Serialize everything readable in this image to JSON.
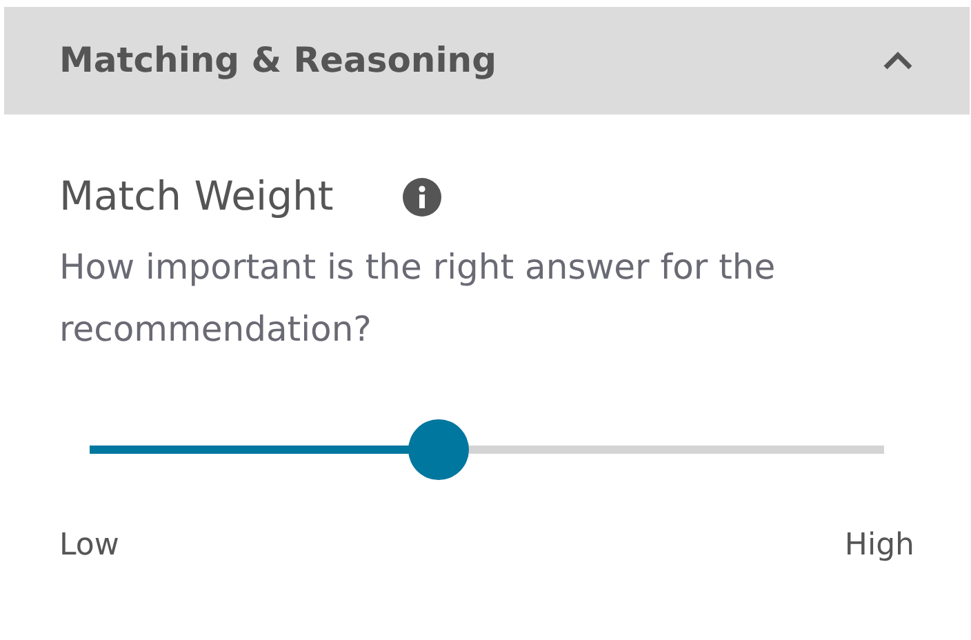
{
  "section": {
    "title": "Matching & Reasoning",
    "expanded": true
  },
  "setting": {
    "label": "Match Weight",
    "description": "How important is the right answer for the recommendation?"
  },
  "slider": {
    "level": 0.44,
    "min_label": "Low",
    "max_label": "High"
  }
}
